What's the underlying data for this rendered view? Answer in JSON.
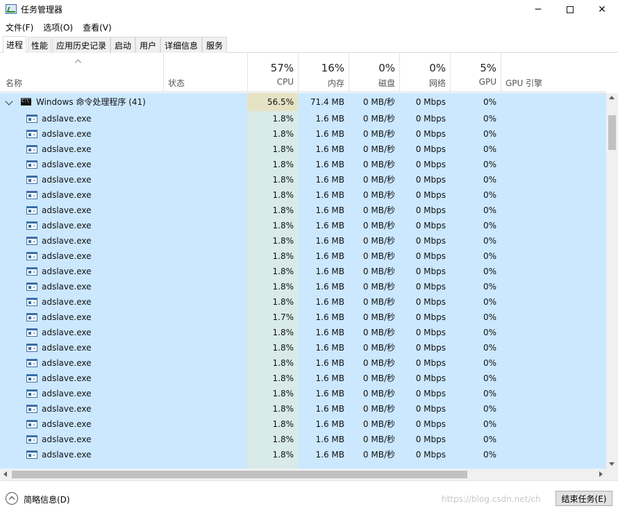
{
  "window": {
    "title": "任务管理器",
    "controls": {
      "minimize": "─",
      "close": "✕"
    }
  },
  "menu": [
    "文件(F)",
    "选项(O)",
    "查看(V)"
  ],
  "tabs": [
    "进程",
    "性能",
    "应用历史记录",
    "启动",
    "用户",
    "详细信息",
    "服务"
  ],
  "active_tab": "进程",
  "columns": {
    "name": "名称",
    "status": "状态",
    "cpu": {
      "pct": "57%",
      "label": "CPU"
    },
    "memory": {
      "pct": "16%",
      "label": "内存"
    },
    "disk": {
      "pct": "0%",
      "label": "磁盘"
    },
    "network": {
      "pct": "0%",
      "label": "网络"
    },
    "gpu": {
      "pct": "5%",
      "label": "GPU"
    },
    "gpu_engine": "GPU 引擎"
  },
  "group": {
    "name": "Windows 命令处理程序 (41)",
    "cpu": "56.5%",
    "memory": "71.4 MB",
    "disk": "0 MB/秒",
    "network": "0 Mbps",
    "gpu": "0%"
  },
  "rows": [
    {
      "name": "adslave.exe",
      "cpu": "1.8%",
      "memory": "1.6 MB",
      "disk": "0 MB/秒",
      "network": "0 Mbps",
      "gpu": "0%"
    },
    {
      "name": "adslave.exe",
      "cpu": "1.8%",
      "memory": "1.6 MB",
      "disk": "0 MB/秒",
      "network": "0 Mbps",
      "gpu": "0%"
    },
    {
      "name": "adslave.exe",
      "cpu": "1.8%",
      "memory": "1.6 MB",
      "disk": "0 MB/秒",
      "network": "0 Mbps",
      "gpu": "0%"
    },
    {
      "name": "adslave.exe",
      "cpu": "1.8%",
      "memory": "1.6 MB",
      "disk": "0 MB/秒",
      "network": "0 Mbps",
      "gpu": "0%"
    },
    {
      "name": "adslave.exe",
      "cpu": "1.8%",
      "memory": "1.6 MB",
      "disk": "0 MB/秒",
      "network": "0 Mbps",
      "gpu": "0%"
    },
    {
      "name": "adslave.exe",
      "cpu": "1.8%",
      "memory": "1.6 MB",
      "disk": "0 MB/秒",
      "network": "0 Mbps",
      "gpu": "0%"
    },
    {
      "name": "adslave.exe",
      "cpu": "1.8%",
      "memory": "1.6 MB",
      "disk": "0 MB/秒",
      "network": "0 Mbps",
      "gpu": "0%"
    },
    {
      "name": "adslave.exe",
      "cpu": "1.8%",
      "memory": "1.6 MB",
      "disk": "0 MB/秒",
      "network": "0 Mbps",
      "gpu": "0%"
    },
    {
      "name": "adslave.exe",
      "cpu": "1.8%",
      "memory": "1.6 MB",
      "disk": "0 MB/秒",
      "network": "0 Mbps",
      "gpu": "0%"
    },
    {
      "name": "adslave.exe",
      "cpu": "1.8%",
      "memory": "1.6 MB",
      "disk": "0 MB/秒",
      "network": "0 Mbps",
      "gpu": "0%"
    },
    {
      "name": "adslave.exe",
      "cpu": "1.8%",
      "memory": "1.6 MB",
      "disk": "0 MB/秒",
      "network": "0 Mbps",
      "gpu": "0%"
    },
    {
      "name": "adslave.exe",
      "cpu": "1.8%",
      "memory": "1.6 MB",
      "disk": "0 MB/秒",
      "network": "0 Mbps",
      "gpu": "0%"
    },
    {
      "name": "adslave.exe",
      "cpu": "1.8%",
      "memory": "1.6 MB",
      "disk": "0 MB/秒",
      "network": "0 Mbps",
      "gpu": "0%"
    },
    {
      "name": "adslave.exe",
      "cpu": "1.7%",
      "memory": "1.6 MB",
      "disk": "0 MB/秒",
      "network": "0 Mbps",
      "gpu": "0%"
    },
    {
      "name": "adslave.exe",
      "cpu": "1.8%",
      "memory": "1.6 MB",
      "disk": "0 MB/秒",
      "network": "0 Mbps",
      "gpu": "0%"
    },
    {
      "name": "adslave.exe",
      "cpu": "1.8%",
      "memory": "1.6 MB",
      "disk": "0 MB/秒",
      "network": "0 Mbps",
      "gpu": "0%"
    },
    {
      "name": "adslave.exe",
      "cpu": "1.8%",
      "memory": "1.6 MB",
      "disk": "0 MB/秒",
      "network": "0 Mbps",
      "gpu": "0%"
    },
    {
      "name": "adslave.exe",
      "cpu": "1.8%",
      "memory": "1.6 MB",
      "disk": "0 MB/秒",
      "network": "0 Mbps",
      "gpu": "0%"
    },
    {
      "name": "adslave.exe",
      "cpu": "1.8%",
      "memory": "1.6 MB",
      "disk": "0 MB/秒",
      "network": "0 Mbps",
      "gpu": "0%"
    },
    {
      "name": "adslave.exe",
      "cpu": "1.8%",
      "memory": "1.6 MB",
      "disk": "0 MB/秒",
      "network": "0 Mbps",
      "gpu": "0%"
    },
    {
      "name": "adslave.exe",
      "cpu": "1.8%",
      "memory": "1.6 MB",
      "disk": "0 MB/秒",
      "network": "0 Mbps",
      "gpu": "0%"
    },
    {
      "name": "adslave.exe",
      "cpu": "1.8%",
      "memory": "1.6 MB",
      "disk": "0 MB/秒",
      "network": "0 Mbps",
      "gpu": "0%"
    },
    {
      "name": "adslave.exe",
      "cpu": "1.8%",
      "memory": "1.6 MB",
      "disk": "0 MB/秒",
      "network": "0 Mbps",
      "gpu": "0%"
    }
  ],
  "footer": {
    "fewer_details": "简略信息(D)",
    "end_task": "结束任务(E)",
    "watermark": "https://blog.csdn.net/ch"
  },
  "colors": {
    "selection": "#cce8ff",
    "cpu_column": "#d8ebe8",
    "cpu_highlight": "#e6e2c4"
  }
}
